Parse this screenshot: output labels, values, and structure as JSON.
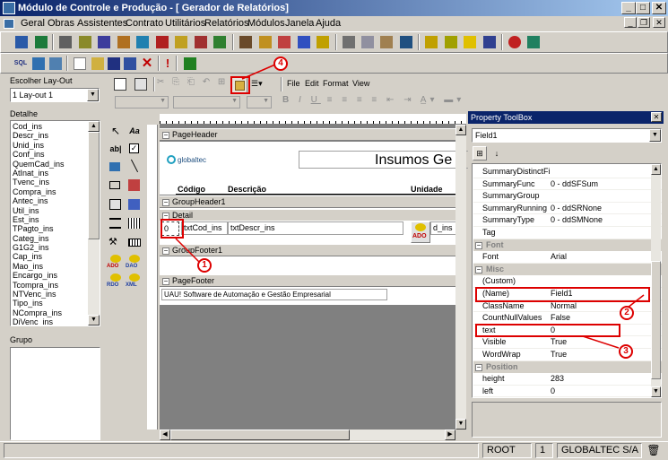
{
  "window": {
    "title": "Módulo de Controle e Produção - [ Gerador de Relatórios]"
  },
  "title_buttons": [
    "_",
    "□",
    "✕"
  ],
  "mdi_buttons": [
    "_",
    "❐",
    "✕"
  ],
  "menu": [
    "Geral",
    "Obras",
    "Assistentes",
    "Contrato",
    "Utilitários",
    "Relatórios",
    "Módulos",
    "Janela",
    "Ajuda"
  ],
  "toolbar_sql": "SQL",
  "designer_menu": [
    "File",
    "Edit",
    "Format",
    "View"
  ],
  "left_panel": {
    "layout_label": "Escolher Lay-Out",
    "layout_value": "1  Lay-out 1",
    "detail_label": "Detalhe",
    "fields": [
      "Cod_ins",
      "Descr_ins",
      "Unid_ins",
      "Conf_ins",
      "QuemCad_ins",
      "AtInat_ins",
      "Tvenc_ins",
      "Compra_ins",
      "Antec_ins",
      "Util_ins",
      "Est_ins",
      "TPagto_ins",
      "Categ_ins",
      "G1G2_ins",
      "Cap_ins",
      "Mao_ins",
      "Encargo_ins",
      "Tcompra_ins",
      "NTVenc_ins",
      "Tipo_ins",
      "NCompra_ins",
      "DiVenc_ins"
    ],
    "group_label": "Grupo"
  },
  "toolbox": {
    "pointer_icon": "pointer-icon",
    "label_icon": "Aa",
    "textbox_icon": "ab|",
    "ado_label": "ADO",
    "dao_label": "DAO",
    "rdo_label": "RDO",
    "xml_label": "XML"
  },
  "report": {
    "sections": {
      "page_header": "PageHeader",
      "group_header": "GroupHeader1",
      "detail": "Detail",
      "group_footer": "GroupFooter1",
      "page_footer": "PageFooter"
    },
    "logo_text": "globaltec",
    "report_title": "Insumos Ge",
    "col_codigo": "Código",
    "col_descricao": "Descrição",
    "col_unidade": "Unidade",
    "field1_value": "0",
    "txt_cod": "txtCod_ins",
    "txt_descr": "txtDescr_ins",
    "txt_unid": "d_ins",
    "ado_badge": "ADO",
    "footer_text": "UAU! Software de Automação e Gestão Empresarial"
  },
  "property_toolbox": {
    "title": "Property ToolBox",
    "selected_object": "Field1",
    "rows": [
      {
        "type": "prop",
        "name": "SummaryDistinctFie",
        "value": ""
      },
      {
        "type": "prop",
        "name": "SummaryFunc",
        "value": "0 - ddSFSum"
      },
      {
        "type": "prop",
        "name": "SummaryGroup",
        "value": ""
      },
      {
        "type": "prop",
        "name": "SummaryRunning",
        "value": "0 - ddSRNone"
      },
      {
        "type": "prop",
        "name": "SummaryType",
        "value": "0 - ddSMNone"
      },
      {
        "type": "prop",
        "name": "Tag",
        "value": ""
      },
      {
        "type": "cat",
        "name": "Font"
      },
      {
        "type": "prop",
        "name": "Font",
        "value": "Arial"
      },
      {
        "type": "cat",
        "name": "Misc"
      },
      {
        "type": "prop",
        "name": "(Custom)",
        "value": ""
      },
      {
        "type": "prop",
        "name": "(Name)",
        "value": "Field1"
      },
      {
        "type": "prop",
        "name": "ClassName",
        "value": "Normal"
      },
      {
        "type": "prop",
        "name": "CountNullValues",
        "value": "False"
      },
      {
        "type": "prop",
        "name": "text",
        "value": "0"
      },
      {
        "type": "prop",
        "name": "Visible",
        "value": "True"
      },
      {
        "type": "prop",
        "name": "WordWrap",
        "value": "True"
      },
      {
        "type": "cat",
        "name": "Position"
      },
      {
        "type": "prop",
        "name": "height",
        "value": "283"
      },
      {
        "type": "prop",
        "name": "left",
        "value": "0"
      }
    ]
  },
  "callouts": [
    "1",
    "2",
    "3",
    "4"
  ],
  "status_bar": {
    "user": "ROOT",
    "company_id": "1",
    "company": "GLOBALTEC S/A"
  },
  "colors": {
    "title_start": "#0a246a",
    "title_end": "#a6caf0",
    "callout": "#dd0000",
    "chrome": "#d4d0c8"
  }
}
